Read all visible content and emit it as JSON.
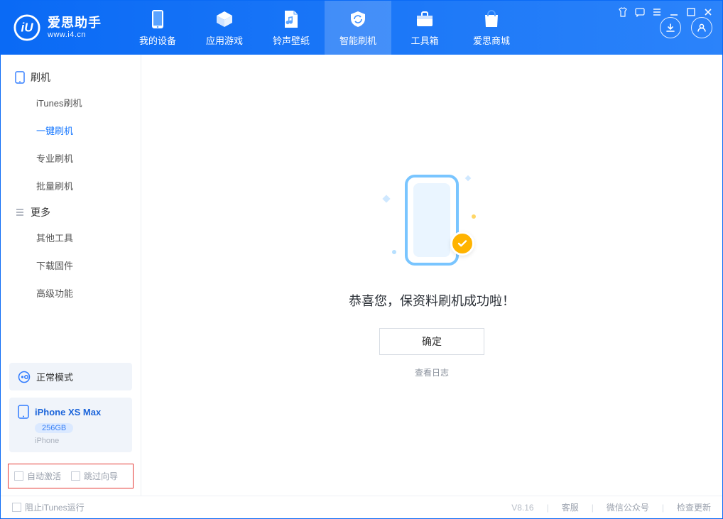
{
  "brand": {
    "name": "爱思助手",
    "sub": "www.i4.cn"
  },
  "nav": {
    "items": [
      {
        "label": "我的设备"
      },
      {
        "label": "应用游戏"
      },
      {
        "label": "铃声壁纸"
      },
      {
        "label": "智能刷机"
      },
      {
        "label": "工具箱"
      },
      {
        "label": "爱思商城"
      }
    ],
    "active_index": 3
  },
  "sidebar": {
    "group_flash": "刷机",
    "group_more": "更多",
    "flash_items": [
      {
        "label": "iTunes刷机"
      },
      {
        "label": "一键刷机"
      },
      {
        "label": "专业刷机"
      },
      {
        "label": "批量刷机"
      }
    ],
    "flash_active_index": 1,
    "more_items": [
      {
        "label": "其他工具"
      },
      {
        "label": "下载固件"
      },
      {
        "label": "高级功能"
      }
    ],
    "mode": "正常模式",
    "device": {
      "name": "iPhone XS Max",
      "capacity": "256GB",
      "sub": "iPhone"
    },
    "chk_auto_activate": "自动激活",
    "chk_skip_guide": "跳过向导"
  },
  "main": {
    "success_text": "恭喜您，保资料刷机成功啦！",
    "ok_label": "确定",
    "view_log": "查看日志"
  },
  "footer": {
    "block_itunes": "阻止iTunes运行",
    "version": "V8.16",
    "links": [
      "客服",
      "微信公众号",
      "检查更新"
    ]
  }
}
